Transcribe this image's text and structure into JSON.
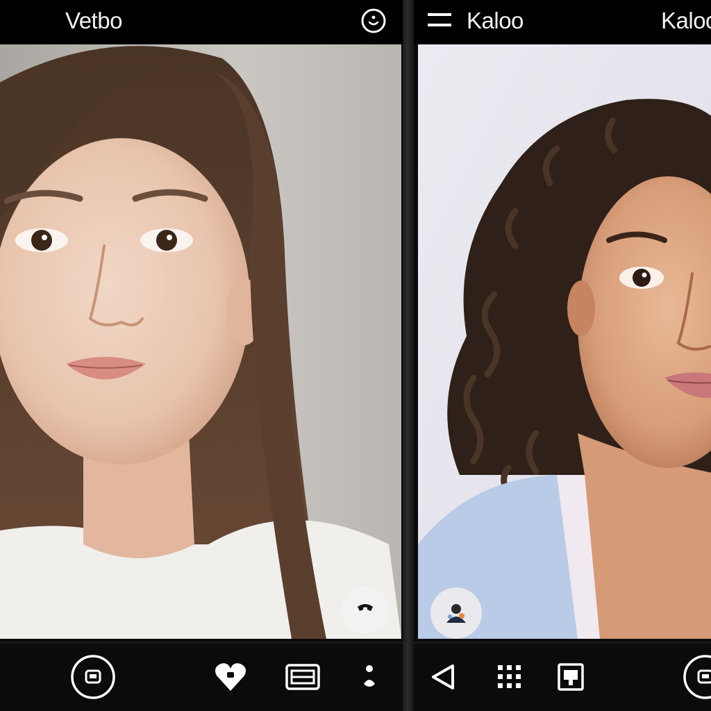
{
  "left_panel": {
    "title": "Vetbo"
  },
  "right_panel": {
    "title": "Kaloo",
    "title_right": "Kaloo"
  },
  "colors": {
    "bar_background": "#000000",
    "icon_color": "#ffffff",
    "left_backdrop": "#bfbcb8",
    "right_backdrop": "#e9e8ef"
  },
  "icons": {
    "left_top": "smiley-icon",
    "right_top": "hamburger-menu-icon",
    "left_bottom": [
      "record-circle-icon",
      "heart-icon",
      "gallery-icon",
      "more-dots-icon"
    ],
    "right_bottom": [
      "back-triangle-icon",
      "grid-dots-icon",
      "portrait-frame-icon",
      "record-circle-icon"
    ],
    "left_float": "mute-icon",
    "right_float": "avatar-icon"
  }
}
